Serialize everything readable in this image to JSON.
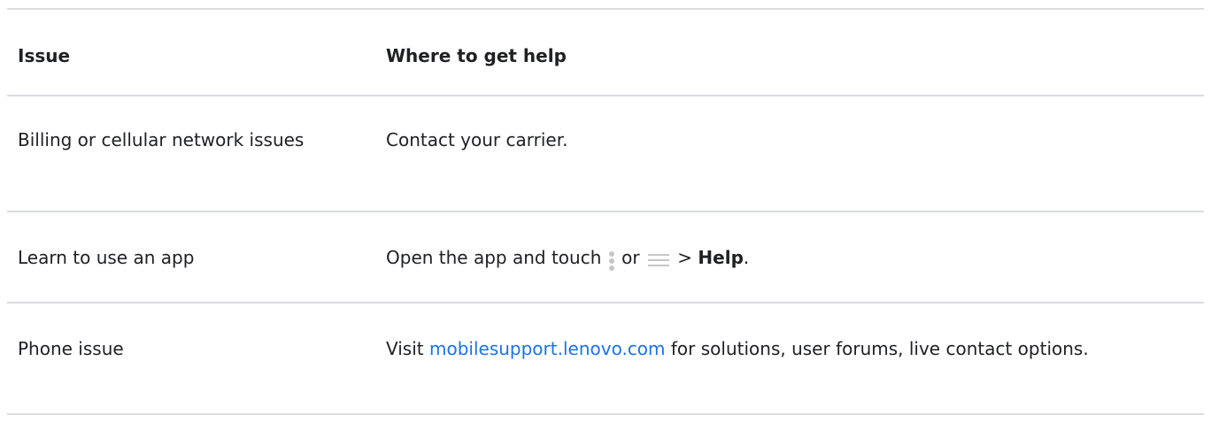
{
  "table": {
    "headers": {
      "issue": "Issue",
      "help": "Where to get help"
    },
    "rows": [
      {
        "issue": "Billing or cellular network issues",
        "help": "Contact your carrier."
      },
      {
        "issue": "Learn to use an app",
        "help_prefix": "Open the app and touch",
        "help_or": "or",
        "help_arrow": ">",
        "help_bold": "Help",
        "help_suffix": ".",
        "icons": [
          "more-vert-icon",
          "menu-icon"
        ]
      },
      {
        "issue": "Phone issue",
        "help_prefix": "Visit",
        "help_link": "mobilesupport.lenovo.com",
        "help_suffix": "for solutions, user forums, live contact options."
      }
    ]
  },
  "colors": {
    "link": "#1a73e8",
    "divider": "#dadce0",
    "text": "#202124",
    "icon": "#c4c7c5"
  }
}
